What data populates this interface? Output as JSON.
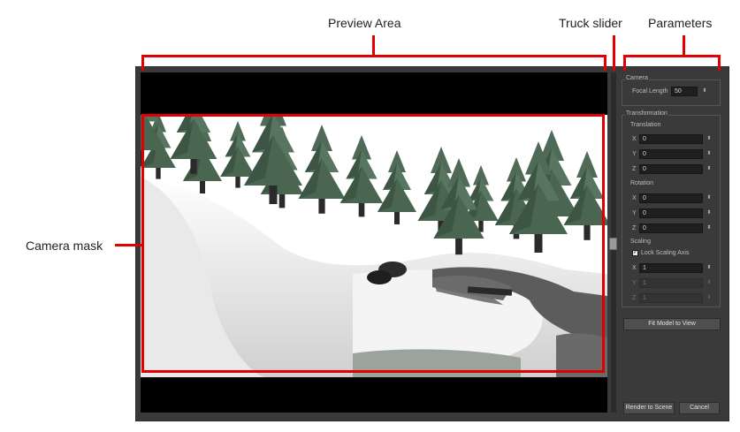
{
  "callouts": {
    "preview_area": "Preview Area",
    "truck_slider": "Truck slider",
    "parameters": "Parameters",
    "camera_mask": "Camera mask"
  },
  "panel": {
    "camera_group": "Camera",
    "focal_length_label": "Focal Length",
    "focal_length_value": "50",
    "transformation_group": "Transformation",
    "translation_label": "Translation",
    "translation": [
      {
        "axis": "X",
        "value": "0"
      },
      {
        "axis": "Y",
        "value": "0"
      },
      {
        "axis": "Z",
        "value": "0"
      }
    ],
    "rotation_label": "Rotation",
    "rotation": [
      {
        "axis": "X",
        "value": "0"
      },
      {
        "axis": "Y",
        "value": "0"
      },
      {
        "axis": "Z",
        "value": "0"
      }
    ],
    "scaling_label": "Scaling",
    "lock_scaling_label": "Lock Scaling Axis",
    "lock_scaling_checked": true,
    "scaling": [
      {
        "axis": "X",
        "value": "1"
      },
      {
        "axis": "Y",
        "value": "1"
      },
      {
        "axis": "Z",
        "value": "1"
      }
    ],
    "spin_glyph": "⬍",
    "check_glyph": "✓",
    "fit_model_button": "Fit Model to View",
    "render_button": "Render to Scene",
    "cancel_button": "Cancel"
  },
  "colors": {
    "annotation_red": "#e00000",
    "dialog_bg": "#3a3a3a",
    "tree_green": "#55705c",
    "snow": "#f2f2f2"
  }
}
